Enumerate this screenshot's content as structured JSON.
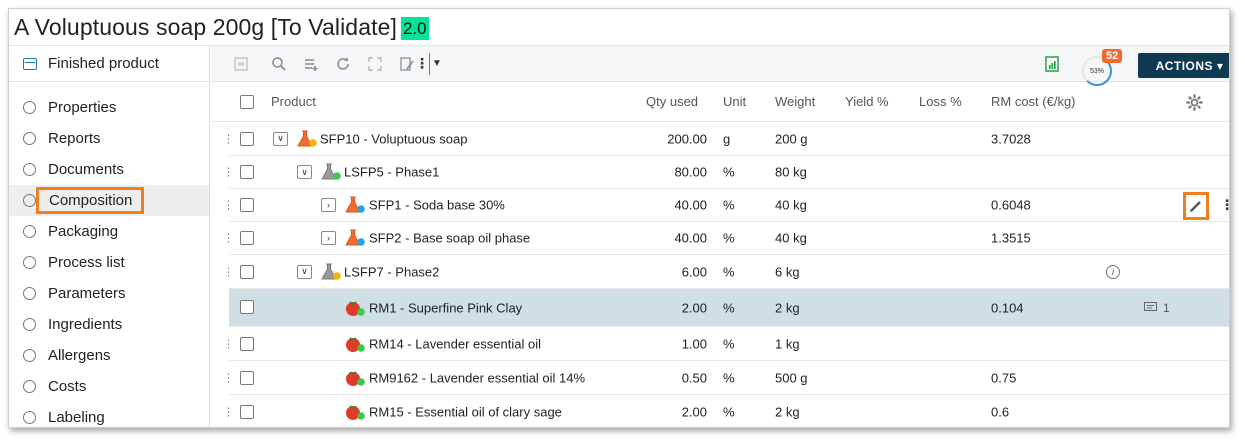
{
  "title": {
    "text": "A Voluptuous soap 200g [To Validate]",
    "version": "2.0"
  },
  "sidebar": {
    "header": "Finished product",
    "items": [
      {
        "label": "Properties"
      },
      {
        "label": "Reports"
      },
      {
        "label": "Documents"
      },
      {
        "label": "Composition",
        "active": true
      },
      {
        "label": "Packaging"
      },
      {
        "label": "Process list"
      },
      {
        "label": "Parameters"
      },
      {
        "label": "Ingredients"
      },
      {
        "label": "Allergens"
      },
      {
        "label": "Costs"
      },
      {
        "label": "Labeling"
      }
    ]
  },
  "toolbar": {
    "progress_percent": "53%",
    "badge_count": "52",
    "actions_label": "ACTIONS ▾"
  },
  "table": {
    "headers": {
      "product": "Product",
      "qty": "Qty used",
      "unit": "Unit",
      "weight": "Weight",
      "yield": "Yield %",
      "loss": "Loss %",
      "rmcost": "RM cost (€/kg)"
    },
    "rows": [
      {
        "name": "SFP10 - Voluptuous soap",
        "qty": "200.00",
        "unit": "g",
        "weight": "200 g",
        "rmcost": "3.7028",
        "icon": "flask-orange-icon",
        "dot": "#f2b705"
      },
      {
        "name": "LSFP5 - Phase1",
        "qty": "80.00",
        "unit": "%",
        "weight": "80 kg",
        "rmcost": "",
        "icon": "flask-gray-icon",
        "dot": "#3cc84a"
      },
      {
        "name": "SFP1 - Soda base 30%",
        "qty": "40.00",
        "unit": "%",
        "weight": "40 kg",
        "rmcost": "0.6048",
        "icon": "flask-orange-icon",
        "dot": "#29a3e0"
      },
      {
        "name": "SFP2 - Base soap oil phase",
        "qty": "40.00",
        "unit": "%",
        "weight": "40 kg",
        "rmcost": "1.3515",
        "icon": "flask-orange-icon",
        "dot": "#29a3e0"
      },
      {
        "name": "LSFP7 - Phase2",
        "qty": "6.00",
        "unit": "%",
        "weight": "6 kg",
        "rmcost": "",
        "icon": "flask-gray-icon",
        "dot": "#f2b705"
      },
      {
        "name": "RM1 - Superfine Pink Clay",
        "qty": "2.00",
        "unit": "%",
        "weight": "2 kg",
        "rmcost": "0.104",
        "icon": "tomato-icon",
        "dot": "#3cc84a",
        "comment_count": "1"
      },
      {
        "name": "RM14 - Lavender essential oil",
        "qty": "1.00",
        "unit": "%",
        "weight": "1 kg",
        "rmcost": "",
        "icon": "tomato-icon",
        "dot": "#3cc84a"
      },
      {
        "name": "RM9162 - Lavender essential oil 14%",
        "qty": "0.50",
        "unit": "%",
        "weight": "500 g",
        "rmcost": "0.75",
        "icon": "tomato-icon",
        "dot": "#3cc84a"
      },
      {
        "name": "RM15 - Essential oil of clary sage",
        "qty": "2.00",
        "unit": "%",
        "weight": "2 kg",
        "rmcost": "0.6",
        "icon": "tomato-icon",
        "dot": "#3cc84a"
      }
    ]
  },
  "colors": {
    "accent_orange": "#f07f1e",
    "actions_bg": "#0e3a52",
    "version_bg": "#00e59a",
    "highlight_row": "#cfdfe4",
    "badge": "#f26b2d"
  }
}
